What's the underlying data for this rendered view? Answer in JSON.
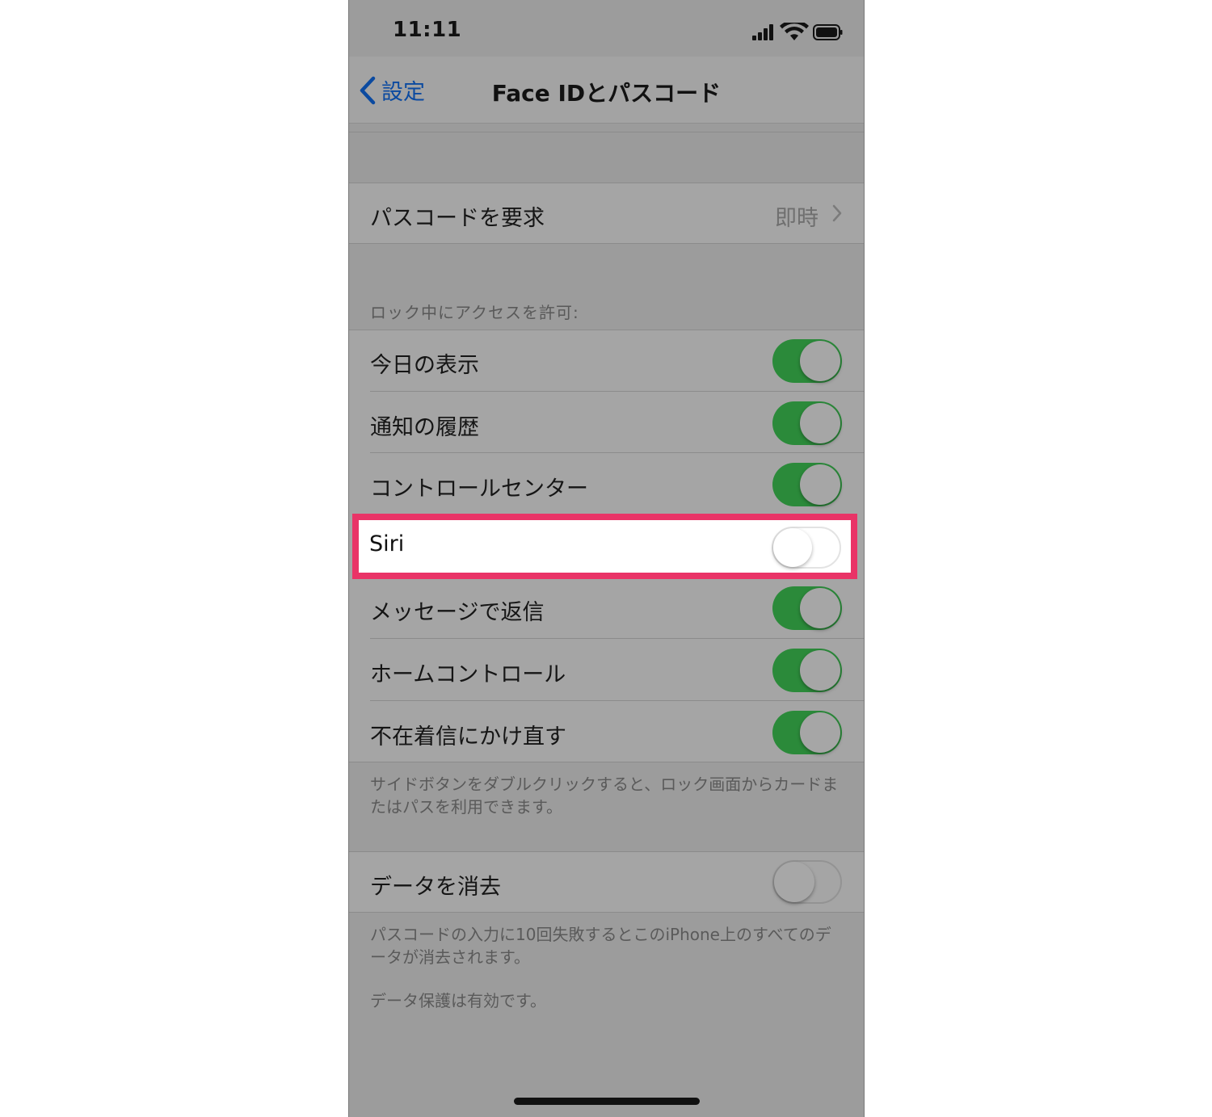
{
  "status": {
    "time": "11:11"
  },
  "nav": {
    "back_label": "設定",
    "title": "Face IDとパスコード"
  },
  "require_passcode": {
    "label": "パスコードを要求",
    "value": "即時"
  },
  "lock_access": {
    "header": "ロック中にアクセスを許可:",
    "items": [
      {
        "label": "今日の表示",
        "state": "on"
      },
      {
        "label": "通知の履歴",
        "state": "on"
      },
      {
        "label": "コントロールセンター",
        "state": "on"
      },
      {
        "label": "Siri",
        "state": "off"
      },
      {
        "label": "メッセージで返信",
        "state": "on"
      },
      {
        "label": "ホームコントロール",
        "state": "on"
      },
      {
        "label": "不在着信にかけ直す",
        "state": "on"
      }
    ],
    "footer": "サイドボタンをダブルクリックすると、ロック画面からカードまたはパスを利用できます。"
  },
  "erase_data": {
    "label": "データを消去",
    "state": "off",
    "footer1": "パスコードの入力に10回失敗するとこのiPhone上のすべてのデータが消去されます。",
    "footer2": "データ保護は有効です。"
  },
  "colors": {
    "highlight": "#e93467",
    "toggle_on": "#2b8a3a",
    "link": "#0b4aa0"
  }
}
